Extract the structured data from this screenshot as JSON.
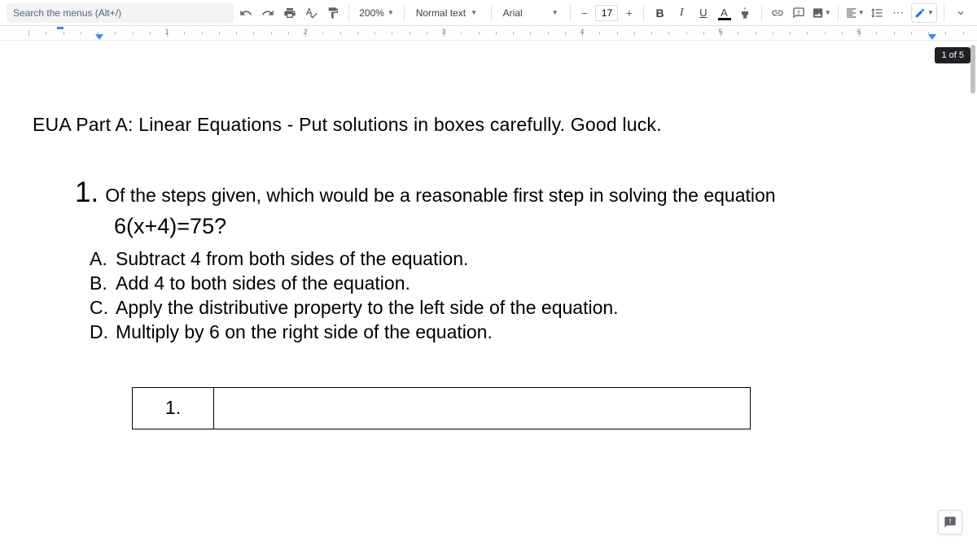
{
  "toolbar": {
    "search_placeholder": "Search the menus (Alt+/)",
    "zoom": "200%",
    "paragraph_style": "Normal text",
    "font": "Arial",
    "font_size": "17",
    "bold": "B",
    "italic": "I",
    "underline": "U",
    "text_color_letter": "A"
  },
  "ruler": {
    "numbers": [
      "1",
      "2",
      "3",
      "4",
      "5",
      "6"
    ]
  },
  "page_indicator": "1 of 5",
  "document": {
    "title": "EUA Part A: Linear Equations  - Put solutions in boxes carefully. Good luck.",
    "question": {
      "number": "1.",
      "prompt": "Of the steps given, which would be a reasonable first step in solving the equation",
      "equation": "6(x+4)=75?",
      "choices": [
        {
          "label": "A.",
          "text": "Subtract 4 from both sides of the equation."
        },
        {
          "label": "B.",
          "text": "Add 4 to both sides of the equation."
        },
        {
          "label": "C.",
          "text": "Apply the distributive property to the left side of the equation."
        },
        {
          "label": "D.",
          "text": "Multiply by 6 on the right side of the equation."
        }
      ],
      "answer_label": "1."
    }
  }
}
